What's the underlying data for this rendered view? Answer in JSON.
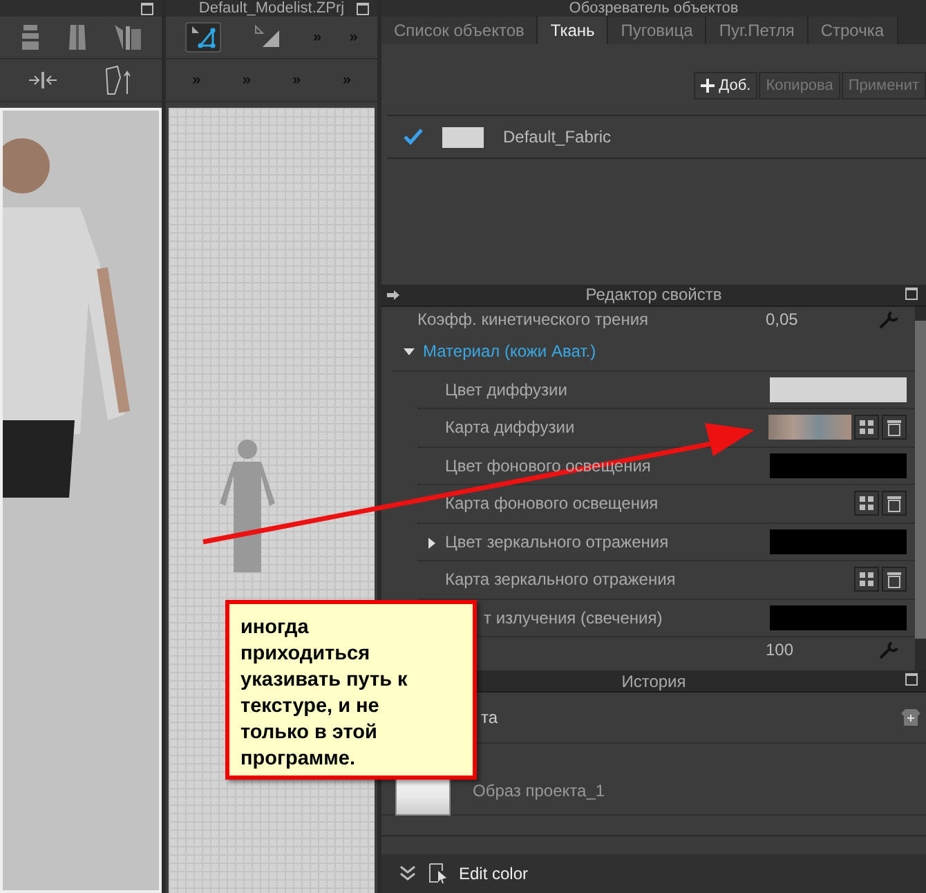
{
  "pattern_panel": {
    "title": "Default_Modelist.ZPrj",
    "tools": [
      {
        "kind": "tool",
        "selected": true
      },
      {
        "kind": "tool",
        "selected": false
      },
      {
        "kind": "more",
        "label": "»"
      },
      {
        "kind": "more",
        "label": "»"
      }
    ],
    "tools_row2": [
      "»",
      "»",
      "»",
      "»"
    ]
  },
  "object_browser": {
    "title": "Обозреватель объектов",
    "tabs": [
      {
        "label": "Список объектов",
        "selected": false
      },
      {
        "label": "Ткань",
        "selected": true
      },
      {
        "label": "Пуговица",
        "selected": false
      },
      {
        "label": "Пуг.Петля",
        "selected": false
      },
      {
        "label": "Строчка",
        "selected": false
      }
    ],
    "buttons": [
      {
        "label": "Доб.",
        "disabled": false
      },
      {
        "label": "Копирова",
        "disabled": true
      },
      {
        "label": "Применит",
        "disabled": true
      }
    ],
    "fabrics": [
      {
        "name": "Default_Fabric",
        "checked": true,
        "color": "#d4d4d4"
      }
    ]
  },
  "property_editor": {
    "title": "Редактор свойств",
    "rows": [
      {
        "kind": "value",
        "label": "Коэфф. кинетического трения",
        "value": "0,05"
      },
      {
        "kind": "section",
        "label": "Материал (кожи Ават.)",
        "expanded": true
      },
      {
        "kind": "color",
        "label": "Цвет диффузии",
        "color": "#d4d4d4"
      },
      {
        "kind": "map",
        "label": "Карта диффузии",
        "has_image": true
      },
      {
        "kind": "color",
        "label": "Цвет фонового освещения",
        "color": "#000000"
      },
      {
        "kind": "map",
        "label": "Карта фонового освещения",
        "has_image": false
      },
      {
        "kind": "color",
        "label": "Цвет зеркального отражения",
        "color": "#000000",
        "expanded": false
      },
      {
        "kind": "map",
        "label": "Карта зеркального отражения",
        "has_image": false
      },
      {
        "kind": "color",
        "label": "т излучения (свечения)",
        "color": "#000000",
        "partial": true
      },
      {
        "kind": "value",
        "label": "",
        "value": "100"
      }
    ]
  },
  "history": {
    "title": "История",
    "items": [
      {
        "label": "та",
        "partial": true,
        "thumbnail": false
      },
      {
        "label": "Образ проекта_1",
        "partial": false,
        "thumbnail": true
      }
    ]
  },
  "bottom_bar": {
    "label": "Edit color"
  },
  "callout": {
    "text": "иногда приходиться указивать путь к текстуре, и не только в этой программе."
  }
}
